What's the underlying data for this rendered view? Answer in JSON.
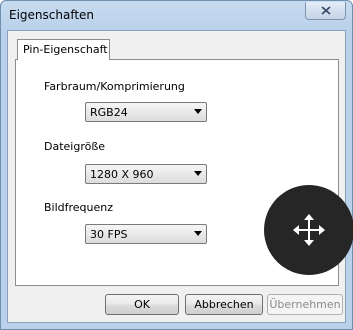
{
  "window": {
    "title": "Eigenschaften",
    "close_icon": "close-icon"
  },
  "tabs": [
    {
      "label": "Pin-Eigenschaft",
      "active": true
    }
  ],
  "fields": {
    "color_space": {
      "label": "Farbraum/Komprimierung",
      "value": "RGB24"
    },
    "file_size": {
      "label": "Dateigröße",
      "value": "1280 X 960"
    },
    "frame_rate": {
      "label": "Bildfrequenz",
      "value": "30 FPS"
    }
  },
  "buttons": {
    "ok": "OK",
    "cancel": "Abbrechen",
    "apply": "Übernehmen"
  },
  "overlay": {
    "icon": "move-icon"
  },
  "colors": {
    "title_bar": "#b9d1ea",
    "dialog_bg": "#f0f0f0",
    "overlay_bg": "#262626"
  }
}
